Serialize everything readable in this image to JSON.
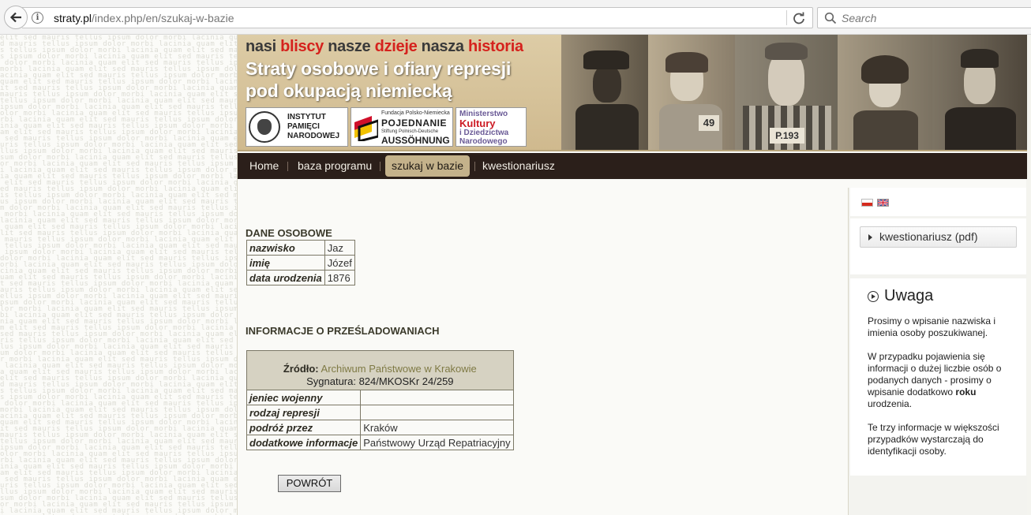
{
  "browser": {
    "url_host": "straty.pl",
    "url_path": "/index.php/en/szukaj-w-bazie",
    "search_placeholder": "Search"
  },
  "banner": {
    "tagline": {
      "w1": "nasi",
      "w2": "bliscy",
      "w3": "nasze",
      "w4": "dzieje",
      "w5": "nasza",
      "w6": "historia"
    },
    "title_line1": "Straty osobowe i ofiary represji",
    "title_line2": "pod okupacją niemiecką",
    "logo_ipn": {
      "l1": "INSTYTUT",
      "l2": "PAMIĘCI",
      "l3": "NARODOWEJ"
    },
    "logo_pj": {
      "l1": "Fundacja Polsko-Niemiecka",
      "l2": "POJEDNANIE",
      "l3": "Stiftung Polnisch-Deutsche",
      "l4": "AUSSÖHNUNG"
    },
    "logo_mk": {
      "l1": "Ministerstwo",
      "l2": "Kultury",
      "l3": "i Dziedzictwa",
      "l4": "Narodowego"
    },
    "photo_numbers": [
      "49",
      "P.193"
    ]
  },
  "nav": {
    "items": [
      {
        "label": "Home"
      },
      {
        "label": "baza programu"
      },
      {
        "label": "szukaj w bazie",
        "active": true
      },
      {
        "label": "kwestionariusz"
      }
    ]
  },
  "personal": {
    "heading": "DANE OSOBOWE",
    "rows": [
      {
        "label": "nazwisko",
        "value": "Jaz"
      },
      {
        "label": "imię",
        "value": "Józef"
      },
      {
        "label": "data urodzenia",
        "value": "1876"
      }
    ]
  },
  "persecution": {
    "heading": "INFORMACJE O PRZEŚLADOWANIACH",
    "source_label": "Źródło:",
    "source_value": "Archiwum Państwowe w Krakowie",
    "signature": "Sygnatura: 824/MKOSKr 24/259",
    "rows": [
      {
        "label": "jeniec wojenny",
        "value": ""
      },
      {
        "label": "rodzaj represji",
        "value": ""
      },
      {
        "label": "podróż przez",
        "value": "Kraków"
      },
      {
        "label": "dodatkowe informacje",
        "value": "Państwowy Urząd Repatriacyjny"
      }
    ]
  },
  "back_button": "POWRÓT",
  "sidebar": {
    "pdf_button": "kwestionariusz (pdf)",
    "uwaga_title": "Uwaga",
    "p1": "Prosimy o wpisanie nazwiska i imienia osoby poszukiwanej.",
    "p2_a": "W przypadku pojawienia się informacji o dużej liczbie osób o podanych danych - prosimy  o wpisanie dodatkowo ",
    "p2_b": "roku",
    "p2_c": " urodzenia.",
    "p3": "Te trzy informacje w większości przypadków wystarczają do identyfikacji osoby."
  },
  "colors": {
    "nav_bg": "#2b1f1a",
    "nav_active": "#c4b28b",
    "tagline_red": "#d5221d",
    "source_link": "#7f7a45"
  }
}
